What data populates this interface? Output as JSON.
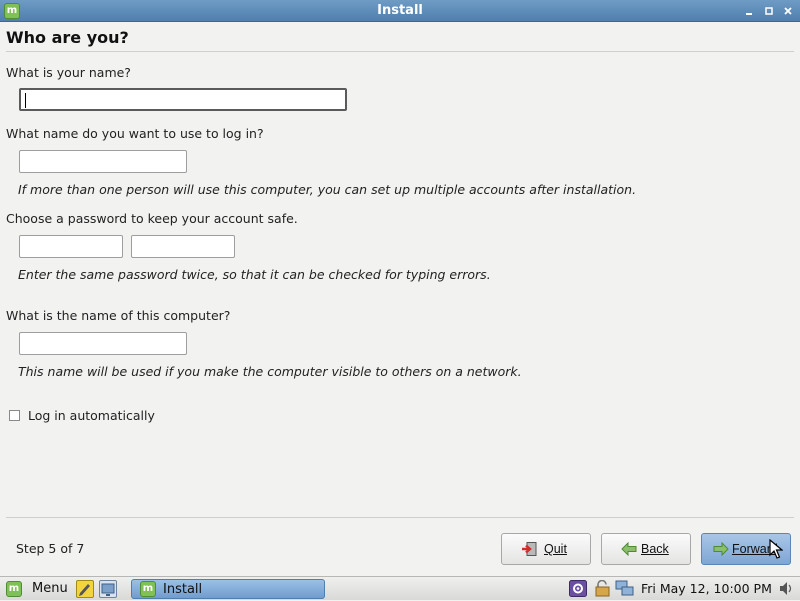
{
  "window": {
    "title": "Install",
    "app_icon": "linux-mint-logo-icon",
    "controls": [
      "minimize-icon",
      "maximize-icon",
      "close-icon"
    ]
  },
  "page": {
    "heading": "Who are you?"
  },
  "form": {
    "name": {
      "label": "What is your name?",
      "value": ""
    },
    "username": {
      "label": "What name do you want to use to log in?",
      "value": "",
      "hint": "If more than one person will use this computer, you can set up multiple accounts after installation."
    },
    "password": {
      "label": "Choose a password to keep your account safe.",
      "value": "",
      "confirm_value": "",
      "hint": "Enter the same password twice, so that it can be checked for typing errors."
    },
    "hostname": {
      "label": "What is the name of this computer?",
      "value": "",
      "hint": "This name will be used if you make the computer visible to others on a network."
    },
    "autologin": {
      "label": "Log in automatically",
      "checked": false
    }
  },
  "footer": {
    "step": "Step 5 of 7",
    "quit_label": "Quit",
    "back_label": "Back",
    "forward_label": "Forward",
    "icons": [
      "quit-icon",
      "back-arrow-icon",
      "forward-arrow-icon"
    ]
  },
  "taskbar": {
    "menu_label": "Menu",
    "task_label": "Install",
    "clock": "Fri May 12, 10:00 PM",
    "icons": [
      "mint-menu-icon",
      "text-editor-icon",
      "desktop-icon",
      "settings-icon",
      "lock-icon",
      "network-icon",
      "volume-icon"
    ]
  },
  "colors": {
    "titlebar": "#4f7fae",
    "forward_button": "#7ea6d4",
    "mint_green": "#7fc157"
  }
}
